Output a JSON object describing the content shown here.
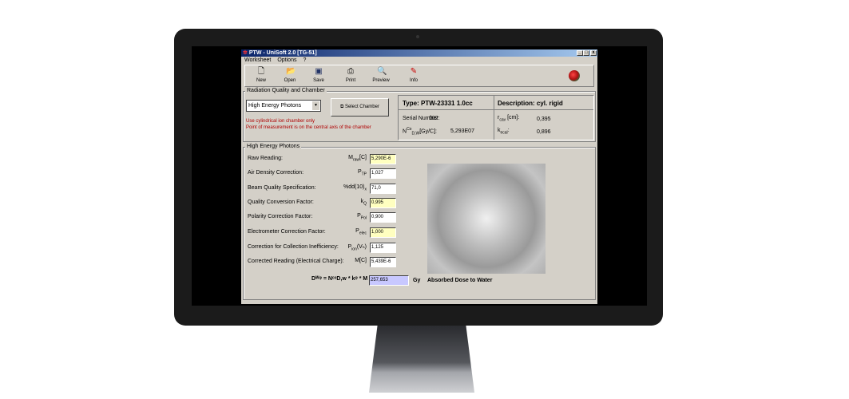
{
  "window": {
    "title": "PTW - UniSoft 2.0  [TG-51]",
    "controls": [
      "_",
      "□",
      "x"
    ]
  },
  "menu": [
    "Worksheet",
    "Options",
    "?"
  ],
  "toolbar": [
    {
      "label": "New",
      "icon": "new-file-icon"
    },
    {
      "label": "Open",
      "icon": "open-folder-icon"
    },
    {
      "label": "Save",
      "icon": "save-disk-icon"
    },
    {
      "label": "Print",
      "icon": "printer-icon"
    },
    {
      "label": "Preview",
      "icon": "preview-icon"
    },
    {
      "label": "Info",
      "icon": "info-icon"
    }
  ],
  "chamber": {
    "group_label": "Radiation Quality and Chamber",
    "quality_select": "High Energy Photons",
    "select_button": "Select Chamber",
    "note1": "Use cylindrical ion chamber only",
    "note2": "Point of measurement is on the central axis of the chamber",
    "type_label": "Type:",
    "type_value": "PTW-23331 1.0cc",
    "desc_label": "Description:",
    "desc_value": "cyl. rigid",
    "serial_label": "Serial Number:",
    "serial_value": "002",
    "ndw_label": "N",
    "ndw_sup": "Co",
    "ndw_sub": "D,W",
    "ndw_unit": "[Gy/C]:",
    "ndw_value": "5,293E07",
    "rcav_label": "r",
    "rcav_sub": "cav",
    "rcav_unit": "[cm]:",
    "rcav_value": "0,395",
    "kecal_label": "k",
    "kecal_sub": "ecal",
    "kecal_unit": ":",
    "kecal_value": "0,896"
  },
  "photons": {
    "group_label": "High Energy Photons",
    "rows": [
      {
        "label": "Raw Reading:",
        "sym": "M",
        "sub": "raw",
        "unit": "[C]",
        "value": "5,290E-6",
        "yellow": true
      },
      {
        "label": "Air Density Correction:",
        "sym": "P",
        "sub": "TP",
        "unit": "",
        "value": "1,027",
        "yellow": false
      },
      {
        "label": "Beam Quality Specification:",
        "sym": "%dd(10)",
        "sub": "x",
        "unit": "",
        "value": "71,0",
        "yellow": false
      },
      {
        "label": "Quality Conversion Factor:",
        "sym": "k",
        "sub": "Q",
        "unit": "",
        "value": "0,995",
        "yellow": true
      },
      {
        "label": "Polarity Correction Factor:",
        "sym": "P",
        "sub": "Pol",
        "unit": "",
        "value": "0,900",
        "yellow": false
      },
      {
        "label": "Electrometer Correction Factor:",
        "sym": "P",
        "sub": "elec",
        "unit": "",
        "value": "1,000",
        "yellow": true
      },
      {
        "label": "Correction for Collection Inefficiency:",
        "sym": "P",
        "sub": "ion",
        "unit": "(Vₕ)",
        "value": "1,125",
        "yellow": false
      },
      {
        "label": "Corrected Reading (Electrical Charge):",
        "sym": "M[C]",
        "sub": "",
        "unit": "",
        "value": "5,439E-6",
        "yellow": false
      }
    ],
    "formula": "Dᵂᵠ = NᶜᵒD,w * kᵠ * M =",
    "result": "257,653",
    "unit": "Gy",
    "result_label": "Absorbed Dose to Water"
  }
}
